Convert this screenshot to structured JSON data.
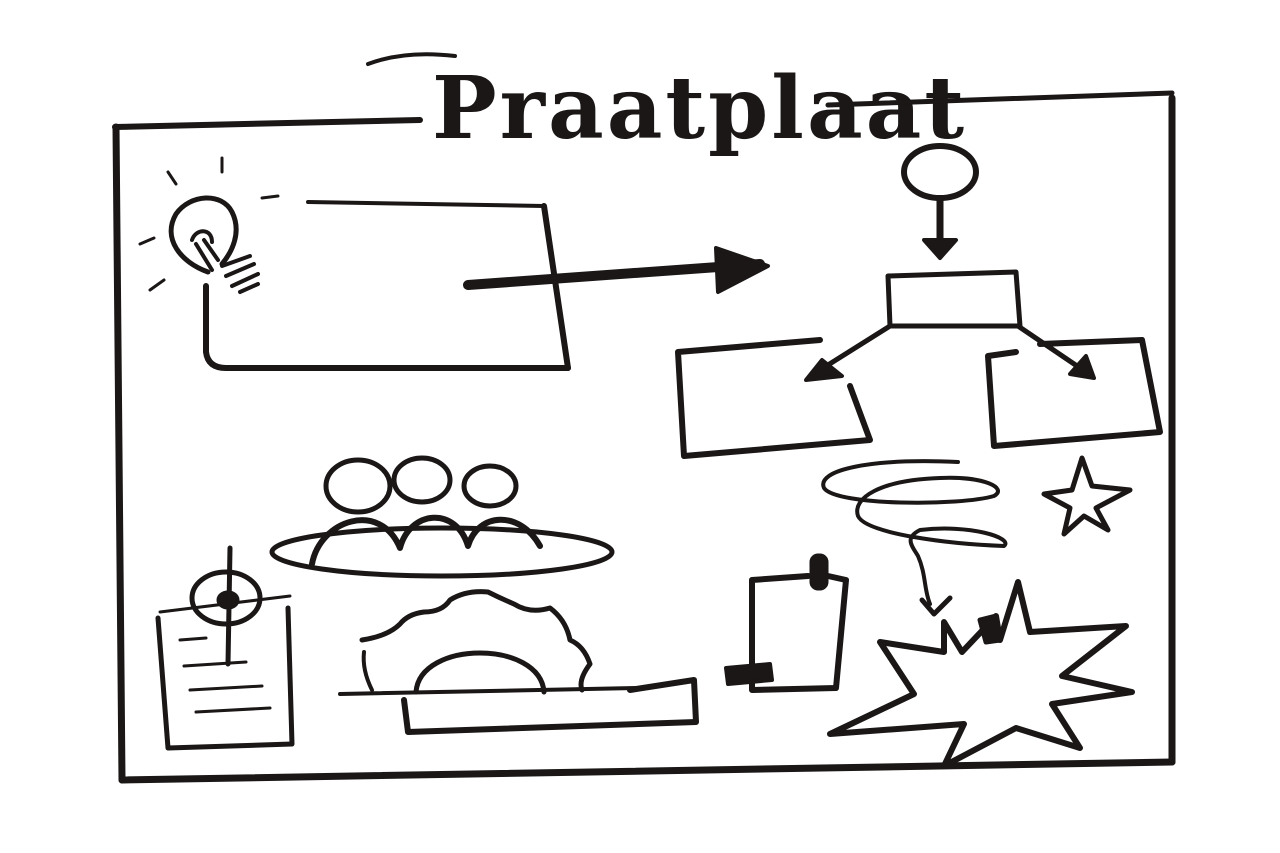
{
  "title": "Praatplaat",
  "colors": {
    "ink": "#1a1716",
    "paper": "#ffffff"
  },
  "icons": [
    "lightbulb-icon",
    "arrow-right-icon",
    "person-icon",
    "people-group-icon",
    "target-icon",
    "sunrise-icon",
    "flag-icon",
    "spiral-icon",
    "star-icon",
    "burst-icon"
  ]
}
